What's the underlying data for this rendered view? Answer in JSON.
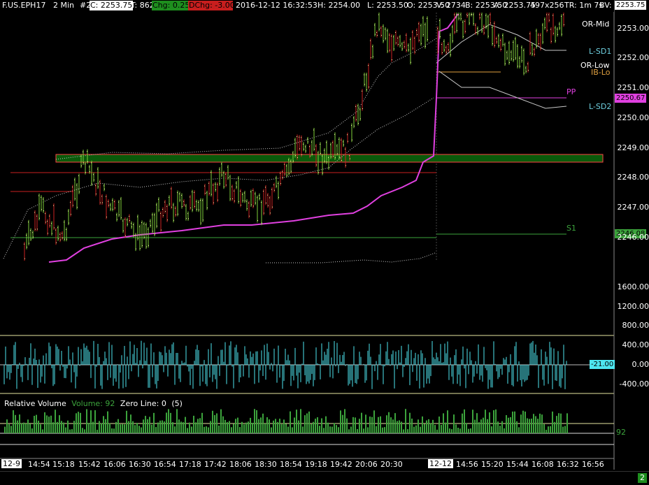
{
  "header": {
    "symbol": "F.US.EPH17",
    "interval": "2 Min",
    "chart_no": "#2",
    "close_label": "C: 2253.75",
    "ticks_label": "T: 862",
    "chg_label": "Chg: 0.25",
    "dchg_label": "DChg: -3.00",
    "datetime": "2016-12-12 16:32:53",
    "h_label": "H: 2254.00",
    "l_label": "L: 2253.50",
    "o_label": "O: 2253.50",
    "v_label": "V: 2734",
    "b_label": "B: 2253.50",
    "a_label": "A: 2253.75",
    "ba_sizes": "497x256",
    "tr_label": "TR: 1m 7s",
    "bv_label": "BV:"
  },
  "price_axis": {
    "labels": [
      "2253.00",
      "2252.00",
      "2251.00",
      "2250.00",
      "2249.00",
      "2248.00",
      "2247.00",
      "2246.00"
    ],
    "current_price_box": "2253.75",
    "pp_box": "2250.67",
    "s1_box": "2246.08"
  },
  "study_labels": {
    "or_mid": "OR-Mid",
    "l_sd1": "L-SD1",
    "or_low": "OR-Low",
    "ib_lo": "IB-Lo",
    "pp": "PP",
    "l_sd2": "L-SD2",
    "s1": "S1"
  },
  "volume_axis": {
    "labels": [
      "1600.00",
      "1200.00",
      "800.00"
    ]
  },
  "osc_panel": {
    "labels": [
      "400.00",
      "0.00",
      "-400.00"
    ],
    "value_box": "-21.00"
  },
  "relvol_panel": {
    "title": "Relative Volume",
    "volume_label": "Volume: 92",
    "zero_line_label": "Zero Line: 0",
    "period_label": "(5)",
    "value_label": "92"
  },
  "time_axis": {
    "date_left": "12-9",
    "date_right": "12-12",
    "ticks": [
      "14:54",
      "15:18",
      "15:42",
      "16:06",
      "16:30",
      "16:54",
      "17:18",
      "17:42",
      "18:06",
      "18:30",
      "18:54",
      "19:18",
      "19:42",
      "20:06",
      "20:30",
      "14:56",
      "15:20",
      "15:44",
      "16:08",
      "16:32",
      "16:56"
    ]
  },
  "statusbar": {
    "badge": "2"
  },
  "colors": {
    "background": "#000000",
    "up_wick": "#7fd03a",
    "bar_ticks": "#ffffaa",
    "down_wick": "#cc2222",
    "vwap": "#e040e0",
    "band_dots": "#c8c8c8",
    "zone_fill": "#0a5a0a",
    "osc": "#4ee6f0",
    "relvol": "#3ca33c",
    "chg_bg": "#1e8e1e",
    "dchg_bg": "#c81e1e"
  }
}
